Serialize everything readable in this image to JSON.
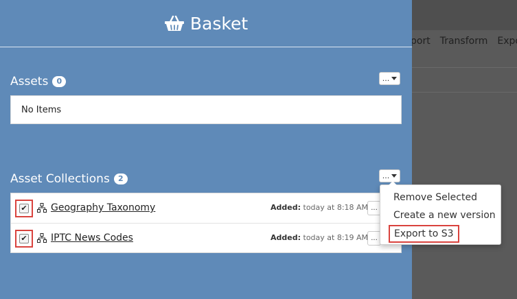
{
  "background_app": {
    "menu": [
      "port",
      "Transform",
      "Expo"
    ]
  },
  "header": {
    "icon": "basket-icon",
    "title": "Basket"
  },
  "assets": {
    "title": "Assets",
    "count": "0",
    "menu_button": "...",
    "empty_text": "No Items"
  },
  "collections": {
    "title": "Asset Collections",
    "count": "2",
    "menu_button": "...",
    "items": [
      {
        "name": "Geography Taxonomy",
        "checked": true,
        "added_label": "Added:",
        "added_time": "today at 8:18 AM",
        "action": "..."
      },
      {
        "name": "IPTC News Codes",
        "checked": true,
        "added_label": "Added:",
        "added_time": "today at 8:19 AM",
        "action": "..."
      }
    ]
  },
  "dropdown": {
    "items": [
      "Remove Selected",
      "Create a new version",
      "Export to S3"
    ]
  },
  "colors": {
    "panel": "#5f8ab8",
    "highlight": "#d9423d",
    "overlay": "#5a5a5a"
  }
}
